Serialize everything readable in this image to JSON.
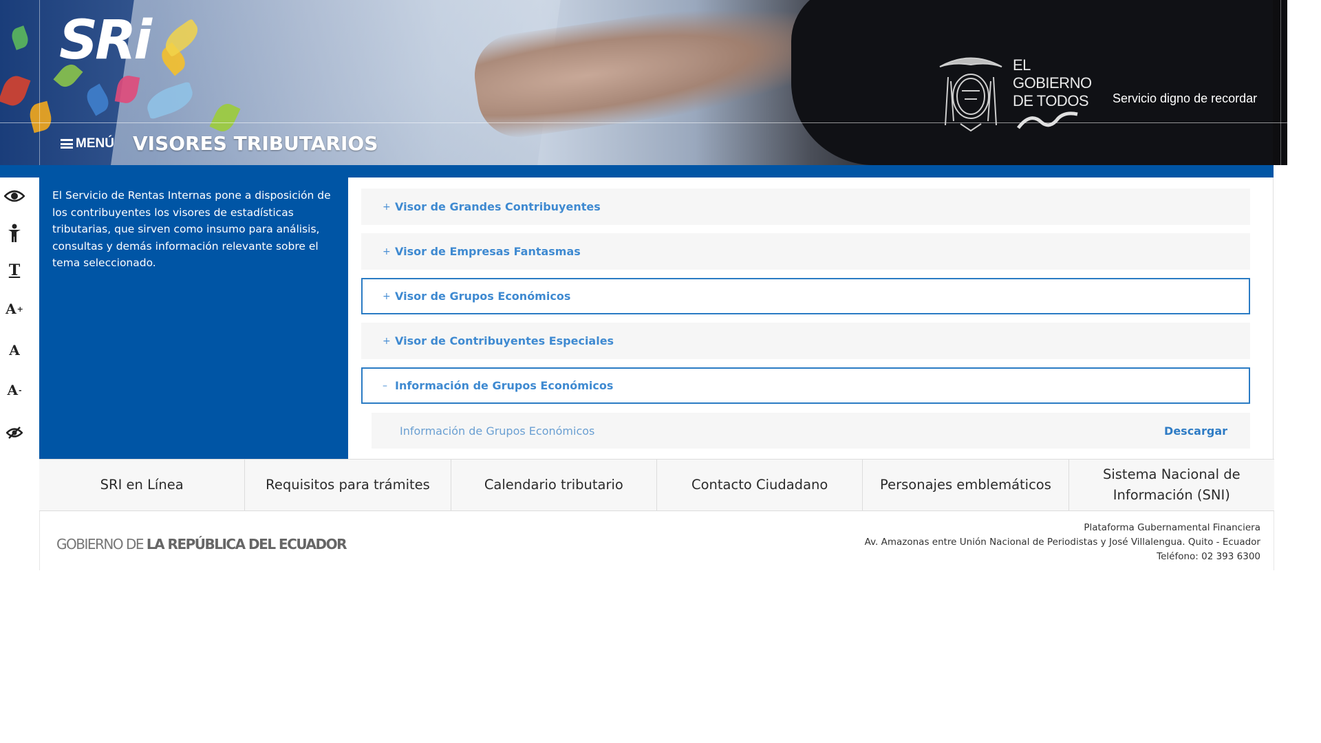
{
  "header": {
    "logo_text": "SRi",
    "government_text_line1": "EL",
    "government_text_line2": "GOBIERNO",
    "government_text_line3": "DE TODOS",
    "tagline": "Servicio digno de recordar",
    "menu_label": "MENÚ",
    "page_title": "VISORES TRIBUTARIOS"
  },
  "accessibility": {
    "tools": [
      "eye-icon",
      "accessibility-person-icon",
      "font-serif-icon",
      "font-increase-icon",
      "font-reset-icon",
      "font-decrease-icon",
      "hide-eye-icon"
    ],
    "font_glyph": "T",
    "a_glyph": "A",
    "plus": "+",
    "minus": "-"
  },
  "intro": {
    "text": "El Servicio de Rentas Internas pone a disposición de los contribuyentes los visores de estadísticas tributarias, que sirven como insumo para análisis, consultas y demás información relevante sobre el tema seleccionado."
  },
  "accordion": {
    "items": [
      {
        "sign": "+",
        "label": "Visor de Grandes Contribuyentes"
      },
      {
        "sign": "+",
        "label": "Visor de Empresas Fantasmas"
      },
      {
        "sign": "+",
        "label": "Visor de Grupos Económicos"
      },
      {
        "sign": "+",
        "label": "Visor de Contribuyentes Especiales"
      },
      {
        "sign": "–",
        "label": "Información de Grupos Económicos"
      }
    ],
    "sub_item": {
      "label": "Información de Grupos Económicos",
      "action": "Descargar"
    }
  },
  "footer_nav": [
    "SRI en Línea",
    "Requisitos para trámites",
    "Calendario tributario",
    "Contacto Ciudadano",
    "Personajes emblemáticos",
    "Sistema Nacional de Información (SNI)"
  ],
  "footer": {
    "gov_logo_prefix": "GOBIERNO DE ",
    "gov_logo_bold": "LA REPÚBLICA DEL ECUADOR",
    "address_line1": "Plataforma Gubernamental Financiera",
    "address_line2": "Av. Amazonas entre Unión Nacional de Periodistas y José Villalengua. Quito - Ecuador",
    "address_line3": "Teléfono: 02 393 6300"
  },
  "colors": {
    "brand_blue": "#0055a5",
    "link_blue": "#3f8ad1",
    "active_border": "#2a7bc4"
  }
}
